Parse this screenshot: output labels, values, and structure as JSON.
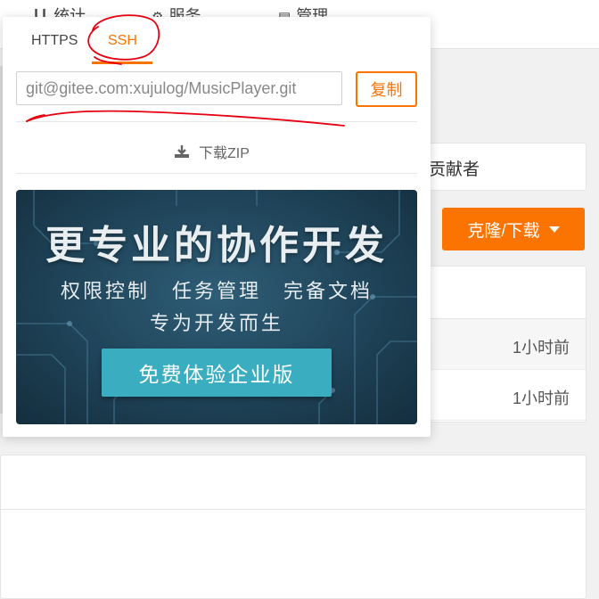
{
  "nav": {
    "stats_label": "统计",
    "service_label": "服务",
    "manage_label": "管理"
  },
  "contributors_label": "贡献者",
  "clone_button_label": "克隆/下载",
  "file_rows": [
    {
      "time": "1小时前"
    },
    {
      "time": "1小时前"
    }
  ],
  "clone_popup": {
    "tabs": [
      "HTTPS",
      "SSH"
    ],
    "active_tab": "SSH",
    "url_value": "git@gitee.com:xujulog/MusicPlayer.git",
    "copy_label": "复制",
    "download_zip_label": "下载ZIP",
    "promo": {
      "title": "更专业的协作开发",
      "features": "权限控制　任务管理　完备文档",
      "subtitle": "专为开发而生",
      "cta": "免费体验企业版"
    }
  },
  "colors": {
    "accent": "#fb7300",
    "promo_button": "#3aaec0",
    "annotation": "#e60012"
  }
}
